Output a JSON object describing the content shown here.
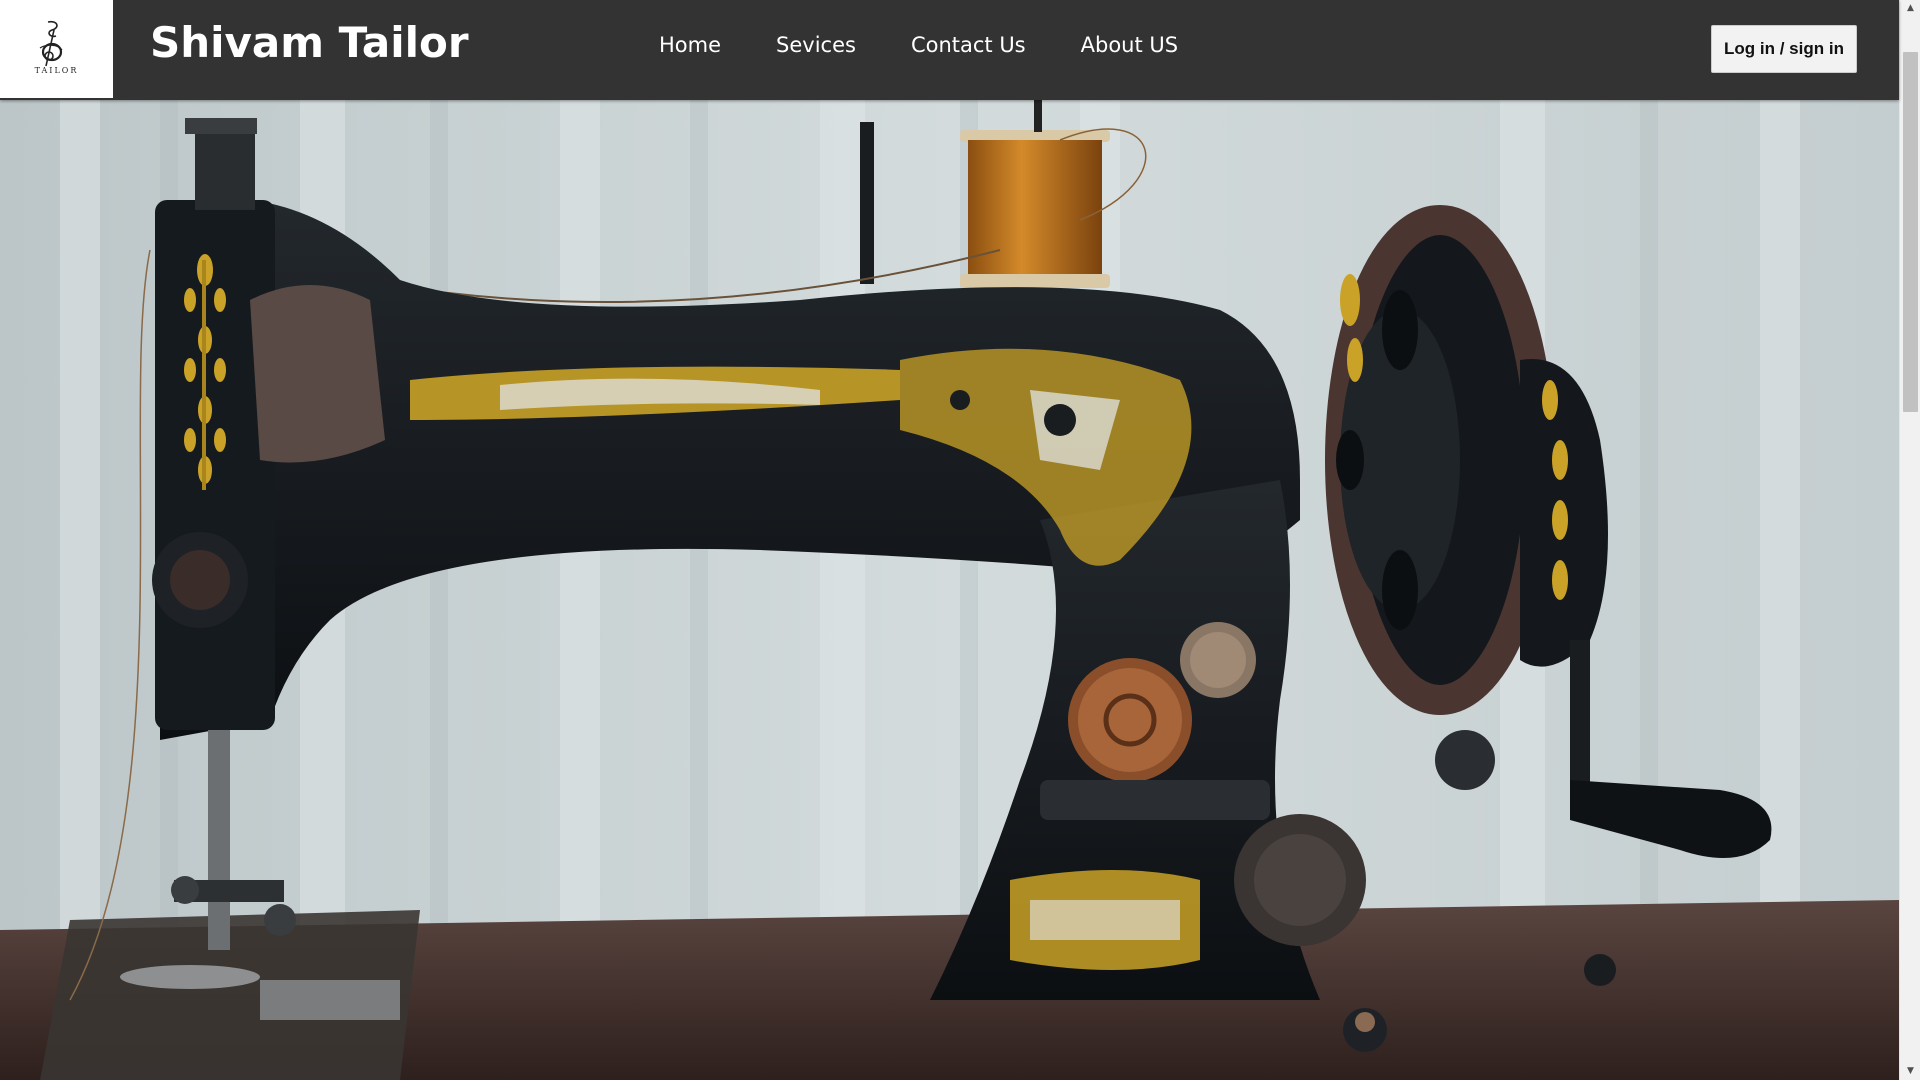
{
  "header": {
    "brand": "Shivam Tailor",
    "logo_text": "TAILOR",
    "nav": [
      {
        "label": "Home"
      },
      {
        "label": "Sevices"
      },
      {
        "label": "Contact Us"
      },
      {
        "label": "About US"
      }
    ],
    "login_label": "Log in / sign in"
  },
  "hero": {
    "image_subject": "vintage-sewing-machine",
    "colors": {
      "header_bg": "#333333",
      "machine_body": "#14181c",
      "gold_decoration": "#c9a227",
      "thread_spool": "#c27a1c",
      "wall": "#c9d2d3",
      "table": "#4a3530"
    }
  },
  "scrollbar": {
    "up_icon": "triangle-up-icon",
    "down_icon": "triangle-down-icon"
  }
}
